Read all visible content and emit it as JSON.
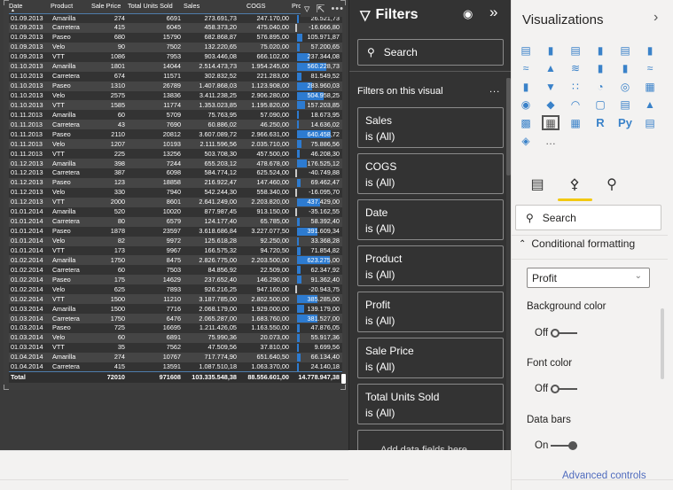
{
  "table": {
    "columns": [
      "Date",
      "Product",
      "Sale Price",
      "Total Units Sold",
      "Sales",
      "COGS",
      "Profit"
    ],
    "sort_indicator": "▲",
    "rows": [
      [
        "01.09.2013",
        "Amarilla",
        "274",
        "6691",
        "273.691,73",
        "247.170,00",
        "26.521,73"
      ],
      [
        "01.09.2013",
        "Carretera",
        "415",
        "6045",
        "458.373,20",
        "475.040,00",
        "-16.666,80"
      ],
      [
        "01.09.2013",
        "Paseo",
        "680",
        "15790",
        "682.868,87",
        "576.895,00",
        "105.971,87"
      ],
      [
        "01.09.2013",
        "Velo",
        "90",
        "7502",
        "132.220,65",
        "75.020,00",
        "57.200,65"
      ],
      [
        "01.09.2013",
        "VTT",
        "1086",
        "7953",
        "903.446,08",
        "666.102,00",
        "237.344,08"
      ],
      [
        "01.10.2013",
        "Amarilla",
        "1801",
        "14044",
        "2.514.473,73",
        "1.954.245,00",
        "560.228,73"
      ],
      [
        "01.10.2013",
        "Carretera",
        "674",
        "11571",
        "302.832,52",
        "221.283,00",
        "81.549,52"
      ],
      [
        "01.10.2013",
        "Paseo",
        "1310",
        "26789",
        "1.407.868,03",
        "1.123.908,00",
        "283.960,03"
      ],
      [
        "01.10.2013",
        "Velo",
        "2575",
        "13836",
        "3.411.238,25",
        "2.906.280,00",
        "504.958,25"
      ],
      [
        "01.10.2013",
        "VTT",
        "1585",
        "11774",
        "1.353.023,85",
        "1.195.820,00",
        "157.203,85"
      ],
      [
        "01.11.2013",
        "Amarilla",
        "60",
        "5709",
        "75.763,95",
        "57.090,00",
        "18.673,95"
      ],
      [
        "01.11.2013",
        "Carretera",
        "43",
        "7690",
        "60.886,02",
        "46.250,00",
        "14.636,02"
      ],
      [
        "01.11.2013",
        "Paseo",
        "2110",
        "20812",
        "3.607.089,72",
        "2.966.631,00",
        "640.458,72"
      ],
      [
        "01.11.2013",
        "Velo",
        "1207",
        "10193",
        "2.111.596,56",
        "2.035.710,00",
        "75.886,56"
      ],
      [
        "01.11.2013",
        "VTT",
        "225",
        "13256",
        "503.708,30",
        "457.500,00",
        "46.208,30"
      ],
      [
        "01.12.2013",
        "Amarilla",
        "398",
        "7244",
        "655.203,12",
        "478.678,00",
        "176.525,12"
      ],
      [
        "01.12.2013",
        "Carretera",
        "387",
        "6098",
        "584.774,12",
        "625.524,00",
        "-40.749,88"
      ],
      [
        "01.12.2013",
        "Paseo",
        "123",
        "18858",
        "216.922,47",
        "147.460,00",
        "69.462,47"
      ],
      [
        "01.12.2013",
        "Velo",
        "330",
        "7940",
        "542.244,30",
        "558.340,00",
        "-16.095,70"
      ],
      [
        "01.12.2013",
        "VTT",
        "2000",
        "8601",
        "2.641.249,00",
        "2.203.820,00",
        "437.429,00"
      ],
      [
        "01.01.2014",
        "Amarilla",
        "520",
        "10020",
        "877.987,45",
        "913.150,00",
        "-35.162,55"
      ],
      [
        "01.01.2014",
        "Carretera",
        "80",
        "6579",
        "124.177,40",
        "65.785,00",
        "58.392,40"
      ],
      [
        "01.01.2014",
        "Paseo",
        "1878",
        "23597",
        "3.618.686,84",
        "3.227.077,50",
        "391.609,34"
      ],
      [
        "01.01.2014",
        "Velo",
        "82",
        "9972",
        "125.618,28",
        "92.250,00",
        "33.368,28"
      ],
      [
        "01.01.2014",
        "VTT",
        "173",
        "9967",
        "166.575,32",
        "94.720,50",
        "71.854,82"
      ],
      [
        "01.02.2014",
        "Amarilla",
        "1750",
        "8475",
        "2.826.775,00",
        "2.203.500,00",
        "623.275,00"
      ],
      [
        "01.02.2014",
        "Carretera",
        "60",
        "7503",
        "84.856,92",
        "22.509,00",
        "62.347,92"
      ],
      [
        "01.02.2014",
        "Paseo",
        "175",
        "14629",
        "237.652,40",
        "146.290,00",
        "91.362,40"
      ],
      [
        "01.02.2014",
        "Velo",
        "625",
        "7893",
        "926.216,25",
        "947.160,00",
        "-20.943,75"
      ],
      [
        "01.02.2014",
        "VTT",
        "1500",
        "11210",
        "3.187.785,00",
        "2.802.500,00",
        "385.285,00"
      ],
      [
        "01.03.2014",
        "Amarilla",
        "1500",
        "7716",
        "2.068.179,00",
        "1.929.000,00",
        "139.179,00"
      ],
      [
        "01.03.2014",
        "Carretera",
        "1750",
        "6476",
        "2.065.287,00",
        "1.683.760,00",
        "381.527,00"
      ],
      [
        "01.03.2014",
        "Paseo",
        "725",
        "16695",
        "1.211.426,05",
        "1.163.550,00",
        "47.876,05"
      ],
      [
        "01.03.2014",
        "Velo",
        "60",
        "6891",
        "75.990,36",
        "20.073,00",
        "55.917,36"
      ],
      [
        "01.03.2014",
        "VTT",
        "35",
        "7562",
        "47.509,56",
        "37.810,00",
        "9.699,56"
      ],
      [
        "01.04.2014",
        "Amarilla",
        "274",
        "10767",
        "717.774,90",
        "651.640,50",
        "66.134,40"
      ],
      [
        "01.04.2014",
        "Carretera",
        "415",
        "13591",
        "1.087.510,18",
        "1.063.370,00",
        "24.140,18"
      ]
    ],
    "profit_numeric": [
      26521.73,
      -16666.8,
      105971.87,
      57200.65,
      237344.08,
      560228.73,
      81549.52,
      283960.03,
      504958.25,
      157203.85,
      18673.95,
      14636.02,
      640458.72,
      75886.56,
      46208.3,
      176525.12,
      -40749.88,
      69462.47,
      -16095.7,
      437429.0,
      -35162.55,
      58392.4,
      391609.34,
      33368.28,
      71854.82,
      623275.0,
      62347.92,
      91362.4,
      -20943.75,
      385285.0,
      139179.0,
      381527.0,
      47876.05,
      55917.36,
      9699.56,
      66134.4,
      24140.18
    ],
    "profit_bar_max": 840458.72,
    "total": [
      "Total",
      "",
      "72010",
      "971608",
      "103.335.548,38",
      "88.556.601,00",
      "14.778.947,38"
    ],
    "header_icons": [
      "filter-icon",
      "focus-mode-icon",
      "more-options-icon"
    ],
    "bar_color": "#2d7bd0",
    "neg_bar_color": "#c8c8c8"
  },
  "filters": {
    "title": "Filters",
    "search_placeholder": "Search",
    "section_title": "Filters on this visual",
    "more": "...",
    "cards": [
      {
        "field": "Sales",
        "state": "is (All)"
      },
      {
        "field": "COGS",
        "state": "is (All)"
      },
      {
        "field": "Date",
        "state": "is (All)"
      },
      {
        "field": "Product",
        "state": "is (All)"
      },
      {
        "field": "Profit",
        "state": "is (All)"
      },
      {
        "field": "Sale Price",
        "state": "is (All)"
      },
      {
        "field": "Total Units Sold",
        "state": "is (All)"
      }
    ],
    "add_data": "Add data fields here"
  },
  "visualizations": {
    "title": "Visualizations",
    "icons": [
      "stacked-bar-chart-icon",
      "stacked-column-chart-icon",
      "clustered-bar-chart-icon",
      "clustered-column-chart-icon",
      "100-stacked-bar-chart-icon",
      "100-stacked-column-chart-icon",
      "line-chart-icon",
      "area-chart-icon",
      "stacked-area-chart-icon",
      "line-and-stacked-column-icon",
      "line-and-clustered-column-icon",
      "ribbon-chart-icon",
      "waterfall-chart-icon",
      "funnel-icon",
      "scatter-chart-icon",
      "pie-chart-icon",
      "donut-chart-icon",
      "treemap-icon",
      "map-icon",
      "filled-map-icon",
      "gauge-icon",
      "card-icon",
      "multi-row-card-icon",
      "kpi-icon",
      "slicer-icon",
      "table-icon",
      "matrix-icon",
      "r-visual-icon",
      "python-visual-icon",
      "decomposition-tree-icon",
      "shape-map-icon",
      "more-visuals-icon"
    ],
    "tabs": [
      "fields-tab",
      "format-tab",
      "analytics-tab"
    ],
    "search_placeholder": "Search",
    "section": "Conditional formatting",
    "field_selected": "Profit",
    "options": [
      {
        "label": "Background color",
        "state": "Off"
      },
      {
        "label": "Font color",
        "state": "Off"
      },
      {
        "label": "Data bars",
        "state": "On"
      }
    ],
    "advanced_link": "Advanced controls",
    "accent": "#f2c811"
  }
}
